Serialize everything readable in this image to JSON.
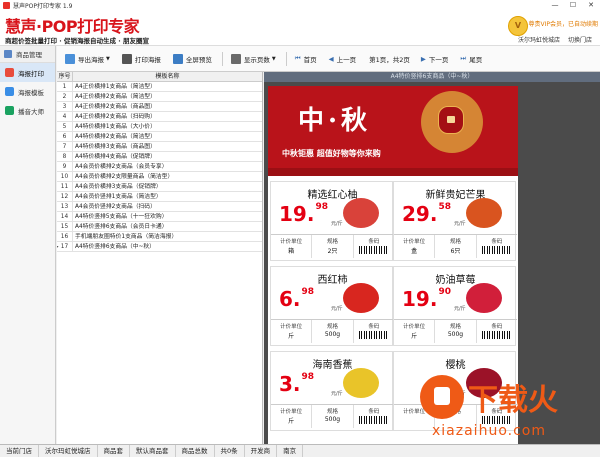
{
  "titlebar": {
    "title": "慧声POP打印专家 1.9",
    "minimize": "—",
    "maximize": "☐",
    "close": "✕"
  },
  "header": {
    "logo": "慧声·POP打印专家",
    "slogan": "商超价签批量打印 · 促销海报自动生成 · 朋友圈宣",
    "vip_status": "尊贵VIP会员，已自动续期",
    "store_name": "沃尔玛虹悦城店",
    "switch_store": "切换门店"
  },
  "sidebar": {
    "top_label": "商品管理",
    "items": [
      {
        "label": "海报打印",
        "icon": "print-icon",
        "color": "#e84c3d"
      },
      {
        "label": "海报模板",
        "icon": "template-icon",
        "color": "#3a8ee6"
      },
      {
        "label": "播音大师",
        "icon": "speaker-icon",
        "color": "#1aa260"
      }
    ]
  },
  "toolbar": {
    "export": "导出海报",
    "print": "打印海报",
    "fullscreen": "全屏预览",
    "show_page": "显示页数",
    "first": "首页",
    "prev": "上一页",
    "page_info": "第1页，共2页",
    "next": "下一页",
    "last": "尾页"
  },
  "grid": {
    "headers": [
      "序号",
      "模板名称"
    ],
    "rows": [
      [
        "1",
        "A4正价横排1支商品（简洁型）"
      ],
      [
        "2",
        "A4正价横排2支商品（简洁型）"
      ],
      [
        "3",
        "A4正价横排2支商品（商品图）"
      ],
      [
        "4",
        "A4正价横排2支商品（扫码购）"
      ],
      [
        "5",
        "A4特价横排1支商品（大小价）"
      ],
      [
        "6",
        "A4特价横排2支商品（简洁型）"
      ],
      [
        "7",
        "A4特价横排3支商品（商品图）"
      ],
      [
        "8",
        "A4特价横排4支商品（促销牌）"
      ],
      [
        "9",
        "A4会员价横排2支商品（会员专享）"
      ],
      [
        "10",
        "A4会员价横排2支限量商品（简洁型）"
      ],
      [
        "11",
        "A4会员价横排3支商品（促销牌）"
      ],
      [
        "12",
        "A4会员价竖排1支商品（简洁型）"
      ],
      [
        "13",
        "A4会员价竖排2支商品（扫码）"
      ],
      [
        "14",
        "A4特价竖排5支商品（十一狂欢购）"
      ],
      [
        "15",
        "A4特价竖排6支商品（会员日卡通）"
      ],
      [
        "16",
        "手机端朋友圈特价1支商品（简洁海报）"
      ],
      [
        "17",
        "A4特价竖排6支商品（中~秋）"
      ]
    ]
  },
  "preview": {
    "title": "A4特价竖排6支商品（中~秋）",
    "banner_title": "中·秋",
    "banner_sub": "中秋钜惠  超值好物等你来购",
    "labels": {
      "unit": "计价单位",
      "spec": "规格",
      "code": "条码",
      "per": "元/斤"
    },
    "products": [
      {
        "name": "精选红心柚",
        "int": "19.",
        "dec": "98",
        "unit": "箱",
        "spec": "2只",
        "fruit_color": "#d9423a"
      },
      {
        "name": "新鲜贵妃芒果",
        "int": "29.",
        "dec": "58",
        "unit": "盒",
        "spec": "6只",
        "fruit_color": "#d9541f"
      },
      {
        "name": "西红柿",
        "int": "6.",
        "dec": "98",
        "unit": "斤",
        "spec": "500g",
        "fruit_color": "#d8261f"
      },
      {
        "name": "奶油草莓",
        "int": "19.",
        "dec": "90",
        "unit": "斤",
        "spec": "500g",
        "fruit_color": "#d11f3a"
      },
      {
        "name": "海南香蕉",
        "int": "3.",
        "dec": "98",
        "unit": "斤",
        "spec": "500g",
        "fruit_color": "#e9c429"
      },
      {
        "name": "樱桃",
        "int": "",
        "dec": "",
        "unit": "",
        "spec": "",
        "fruit_color": "#9b1228"
      }
    ]
  },
  "statusbar": {
    "cells": [
      "当前门店",
      "沃尔玛虹悦城店",
      "商品套",
      "默认商品套",
      "商品总数",
      "共0条",
      "开发商",
      "南京"
    ]
  },
  "watermark": {
    "text": "下载火",
    "url": "xiazaihuo.com"
  }
}
